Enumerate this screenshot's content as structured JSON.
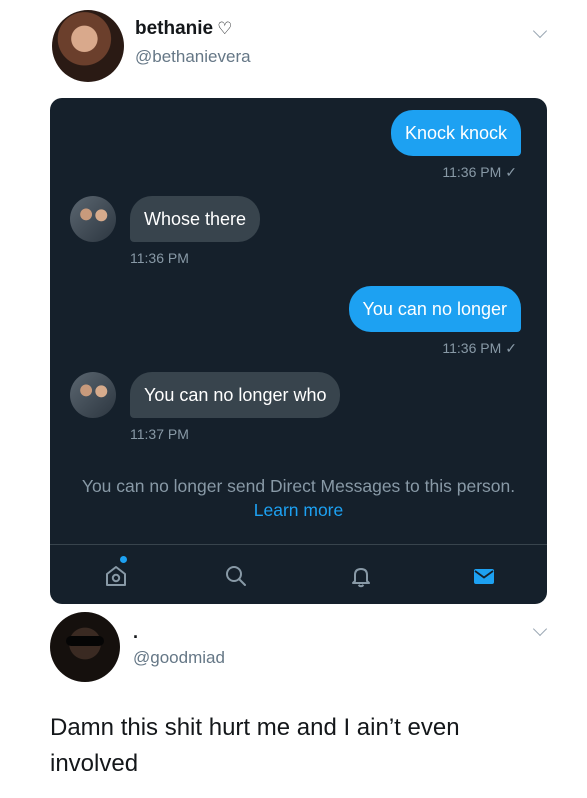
{
  "tweet": {
    "author_name": "bethanie",
    "author_badge_icon": "heart-outline-icon",
    "author_handle": "@bethanievera"
  },
  "dm": {
    "messages": [
      {
        "direction": "out",
        "text": "Knock knock",
        "time": "11:36 PM",
        "status": "✓"
      },
      {
        "direction": "in",
        "text": "Whose there",
        "time": "11:36 PM"
      },
      {
        "direction": "out",
        "text": "You can no longer",
        "time": "11:36 PM",
        "status": "✓"
      },
      {
        "direction": "in",
        "text": "You can no longer who",
        "time": "11:37 PM"
      }
    ],
    "notice": {
      "text": "You can no longer send Direct Messages to this person.",
      "link": "Learn more"
    },
    "nav": [
      {
        "icon": "home-icon",
        "notification_dot": true
      },
      {
        "icon": "search-icon"
      },
      {
        "icon": "bell-icon"
      },
      {
        "icon": "mail-icon",
        "active": true
      }
    ],
    "colors": {
      "background": "#15202b",
      "outgoing": "#1da1f2",
      "incoming": "#38444d"
    }
  },
  "reply": {
    "author_name": ".",
    "author_handle": "@goodmiad",
    "text": "Damn this shit hurt me and I ain’t even involved"
  }
}
